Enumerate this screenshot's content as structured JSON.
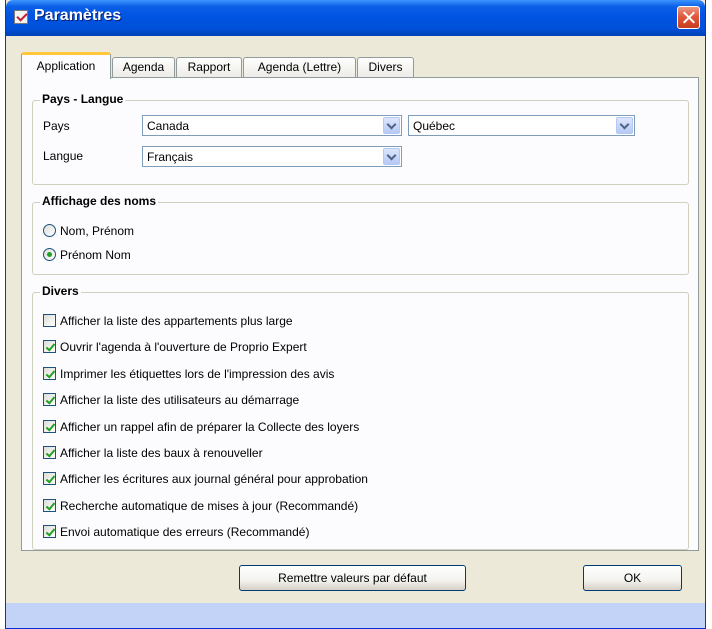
{
  "window": {
    "title": "Paramètres"
  },
  "tabs": [
    "Application",
    "Agenda",
    "Rapport",
    "Agenda (Lettre)",
    "Divers"
  ],
  "pays_langue": {
    "title": "Pays - Langue",
    "pays_label": "Pays",
    "pays_value": "Canada",
    "province_value": "Québec",
    "langue_label": "Langue",
    "langue_value": "Français"
  },
  "affichage": {
    "title": "Affichage des noms",
    "options": [
      {
        "label": "Nom, Prénom",
        "selected": false
      },
      {
        "label": "Prénom Nom",
        "selected": true
      }
    ]
  },
  "divers": {
    "title": "Divers",
    "options": [
      {
        "label": "Afficher la liste des appartements plus large",
        "checked": false
      },
      {
        "label": "Ouvrir l'agenda à l'ouverture de Proprio Expert",
        "checked": true
      },
      {
        "label": "Imprimer les étiquettes lors de l'impression des avis",
        "checked": true
      },
      {
        "label": "Afficher la liste des utilisateurs au démarrage",
        "checked": true
      },
      {
        "label": "Afficher un rappel afin de préparer la Collecte des loyers",
        "checked": true
      },
      {
        "label": "Afficher la liste des baux à renouveller",
        "checked": true
      },
      {
        "label": "Afficher les écritures aux journal général pour approbation",
        "checked": true
      },
      {
        "label": "Recherche automatique de mises à jour (Recommandé)",
        "checked": true
      },
      {
        "label": "Envoi automatique des erreurs (Recommandé)",
        "checked": true
      }
    ]
  },
  "buttons": {
    "reset": "Remettre valeurs par défaut",
    "ok": "OK"
  },
  "colors": {
    "titlebar": "#0054e3",
    "close": "#e2583d",
    "check": "#21a121",
    "tab_highlight": "#ffc83c"
  }
}
